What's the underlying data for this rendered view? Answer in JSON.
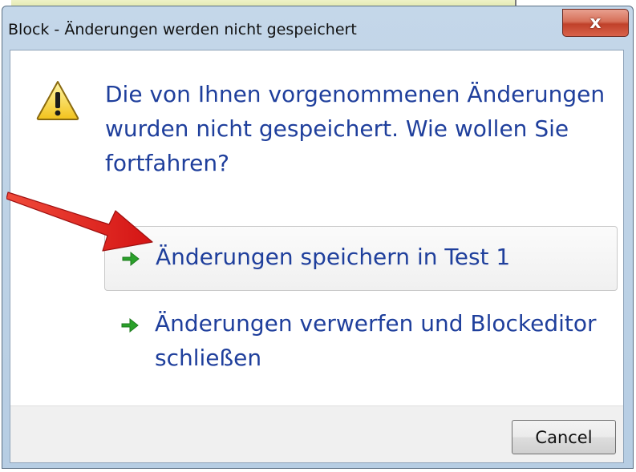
{
  "window": {
    "title": "Block - Änderungen werden nicht gespeichert",
    "close_glyph": "x"
  },
  "dialog": {
    "icon": "warning-icon",
    "main_instruction": "Die von Ihnen vorgenommenen Änderungen wurden nicht gespeichert. Wie wollen Sie fortfahren?",
    "commands": [
      {
        "label": "Änderungen speichern in Test 1",
        "icon": "green-arrow-icon",
        "highlighted": true
      },
      {
        "label": "Änderungen verwerfen und Blockeditor schließen",
        "icon": "green-arrow-icon",
        "highlighted": false
      }
    ],
    "cancel_label": "Cancel"
  },
  "annotation": {
    "type": "red-pointer-arrow",
    "color": "#e01b1b"
  },
  "colors": {
    "instruction_text": "#1f3f9c",
    "command_arrow": "#2aa12a",
    "close_button": "#c0412a"
  }
}
